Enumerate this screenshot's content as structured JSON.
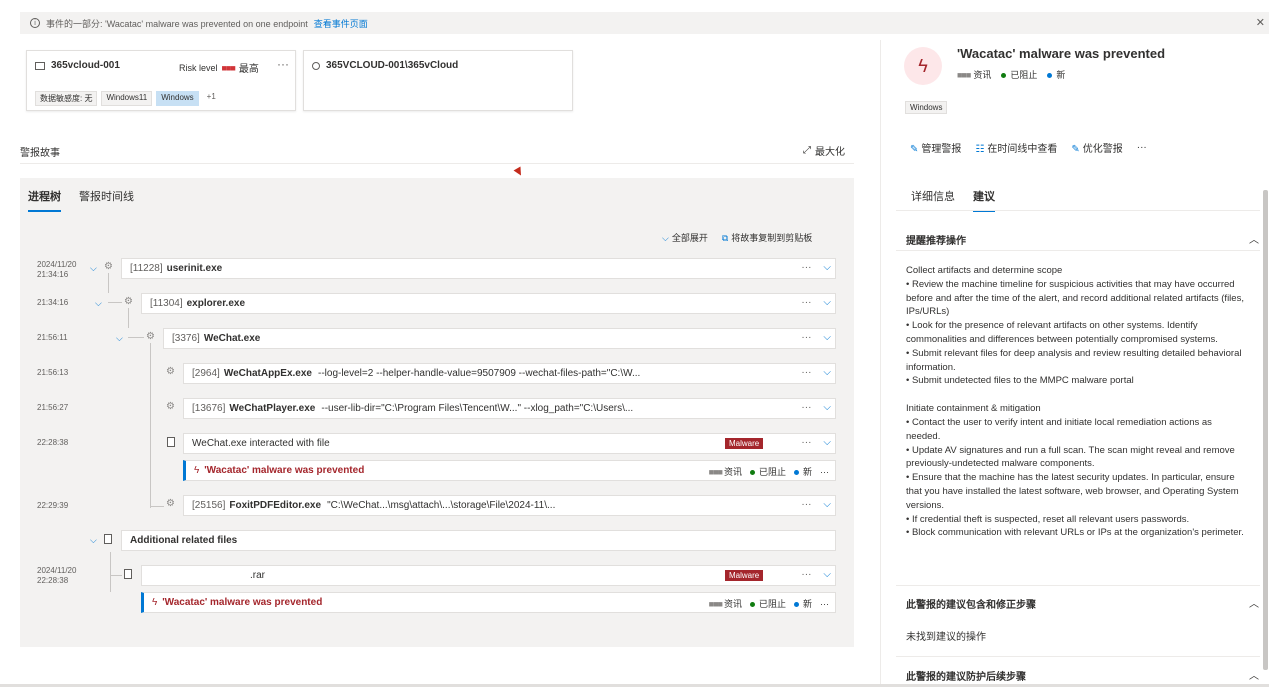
{
  "banner": {
    "text": "事件的一部分: 'Wacatac' malware was prevented on one endpoint",
    "link": "查看事件页面",
    "close": "✕"
  },
  "device_card": {
    "name": "365vcloud-001",
    "risk_label": "Risk level",
    "risk_value": "最高",
    "more": "···",
    "tags": [
      "数据敏感度: 无",
      "Windows11",
      "Windows",
      "+1"
    ]
  },
  "user_card": {
    "name": "365VCLOUD-001\\365vCloud"
  },
  "story": {
    "title": "警报故事",
    "maximize": "最大化",
    "tabs": [
      "进程树",
      "警报时间线"
    ],
    "expand_all": "全部展开",
    "copy": "将故事复制到剪贴板"
  },
  "tree": {
    "timestamps": [
      "2024/11/20",
      "21:34:16",
      "21:34:16",
      "21:56:11",
      "21:56:13",
      "21:56:27",
      "22:28:38",
      "22:29:39",
      "2024/11/20",
      "22:28:38"
    ],
    "nodes": [
      {
        "pid": "[11228]",
        "name": "userinit.exe",
        "args": ""
      },
      {
        "pid": "[11304]",
        "name": "explorer.exe",
        "args": ""
      },
      {
        "pid": "[3376]",
        "name": "WeChat.exe",
        "args": ""
      },
      {
        "pid": "[2964]",
        "name": "WeChatAppEx.exe",
        "args": "--log-level=2 --helper-handle-value=9507909 --wechat-files-path=\"C:\\W..."
      },
      {
        "pid": "[13676]",
        "name": "WeChatPlayer.exe",
        "args": "--user-lib-dir=\"C:\\Program Files\\Tencent\\W...\" --xlog_path=\"C:\\Users\\..."
      },
      {
        "pid": "",
        "name": "",
        "args": "WeChat.exe interacted with file"
      },
      {
        "pid": "[25156]",
        "name": "FoxitPDFEditor.exe",
        "args": "\"C:\\WeChat...\\msg\\attach\\...\\storage\\File\\2024-11\\..."
      }
    ],
    "additional": "Additional related files",
    "rar_name": ".rar",
    "malware": "Malware",
    "alert_title": "'Wacatac' malware was prevented",
    "severity": "资讯",
    "status": "已阻止",
    "state": "新",
    "ellipsis": "···",
    "chevron": "⌵"
  },
  "right_panel": {
    "title": "'Wacatac' malware was prevented",
    "severity": "资讯",
    "status": "已阻止",
    "state": "新",
    "tag": "Windows",
    "actions": [
      "管理警报",
      "在时间线中查看",
      "优化警报",
      "···"
    ],
    "tabs": [
      "详细信息",
      "建议"
    ],
    "section1": "提醒推荐操作",
    "section2": "此警报的建议包含和修正步骤",
    "section3": "此警报的建议防护后续步骤",
    "no_rec": "未找到建议的操作",
    "rec": {
      "h1": "Collect artifacts and determine scope",
      "b1": "•      Review the machine timeline for suspicious activities that may have occurred before and after the time of the alert, and record additional related artifacts (files, IPs/URLs)",
      "b2": "•      Look for the presence of relevant artifacts on other systems. Identify commonalities and differences between potentially compromised systems.",
      "b3": "•      Submit relevant files for deep analysis and review resulting detailed behavioral information.",
      "b4": "•      Submit undetected files to the MMPC malware portal",
      "h2": "Initiate containment & mitigation",
      "c1": "•      Contact the user to verify intent and initiate local remediation actions as needed.",
      "c2": "•      Update AV signatures and run a full scan. The scan might reveal and remove previously-undetected malware components.",
      "c3": "•      Ensure that the machine has the latest security updates. In particular, ensure that you have installed the latest software, web browser, and Operating System versions.",
      "c4": "•      If credential theft is suspected, reset all relevant users passwords.",
      "c5": "•      Block communication with relevant URLs or IPs at the organization's perimeter."
    }
  }
}
